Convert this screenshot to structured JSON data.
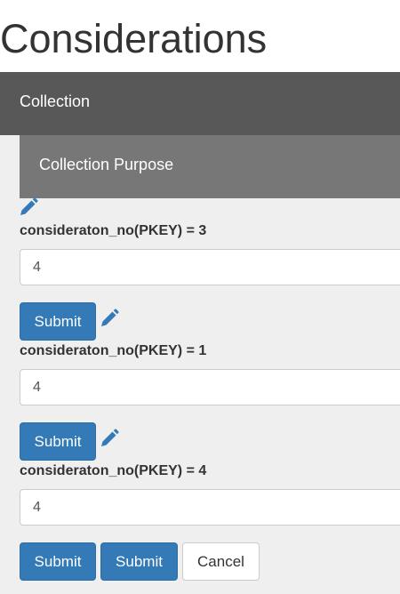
{
  "page": {
    "title": "Considerations"
  },
  "collection": {
    "label": "Collection",
    "purpose_label": "Collection Purpose"
  },
  "records": [
    {
      "label": "consideraton_no(PKEY) = 3",
      "value": "4",
      "submit_label": "Submit"
    },
    {
      "label": "consideraton_no(PKEY) = 1",
      "value": "4",
      "submit_label": "Submit"
    },
    {
      "label": "consideraton_no(PKEY) = 4",
      "value": "4",
      "submit_label": "Submit"
    }
  ],
  "footer_actions": {
    "submit_label": "Submit",
    "cancel_label": "Cancel"
  },
  "icons": {
    "edit": "pencil-icon"
  },
  "colors": {
    "primary": "#337ab7",
    "collection_bar": "#585858",
    "purpose_bar": "#777777",
    "content_background": "#efefef"
  }
}
